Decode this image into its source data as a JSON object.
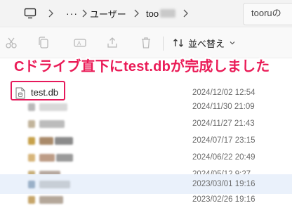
{
  "addressbar": {
    "crumb_user": "ユーザー",
    "crumb_user_folder": "too",
    "right_folder": "tooruの"
  },
  "toolbar": {
    "sort_label": "並べ替え"
  },
  "banner": {
    "text": "Cドライブ直下にtest.dbが完成しました",
    "color": "#ea1b57"
  },
  "files": [
    {
      "name": "test.db",
      "date": "2024/12/02 12:54"
    },
    {
      "name": "",
      "date": "2024/11/30 21:09"
    },
    {
      "name": "",
      "date": "2024/11/27 21:43"
    },
    {
      "name": "",
      "date": "2024/07/17 23:15"
    },
    {
      "name": "",
      "date": "2024/06/22 20:49"
    },
    {
      "name": "",
      "date": "2024/05/12 9:27"
    },
    {
      "name": "",
      "date": "2023/03/01 19:16"
    },
    {
      "name": "",
      "date": "2023/02/26 19:16"
    }
  ],
  "icons": {
    "monitor": "monitor-icon",
    "more": "more-icon",
    "chevron": "chevron-right-icon",
    "cut": "cut-icon",
    "copy": "copy-icon",
    "rename": "rename-icon",
    "share": "share-icon",
    "delete": "delete-icon",
    "sort": "sort-icon",
    "db": "database-file-icon"
  }
}
